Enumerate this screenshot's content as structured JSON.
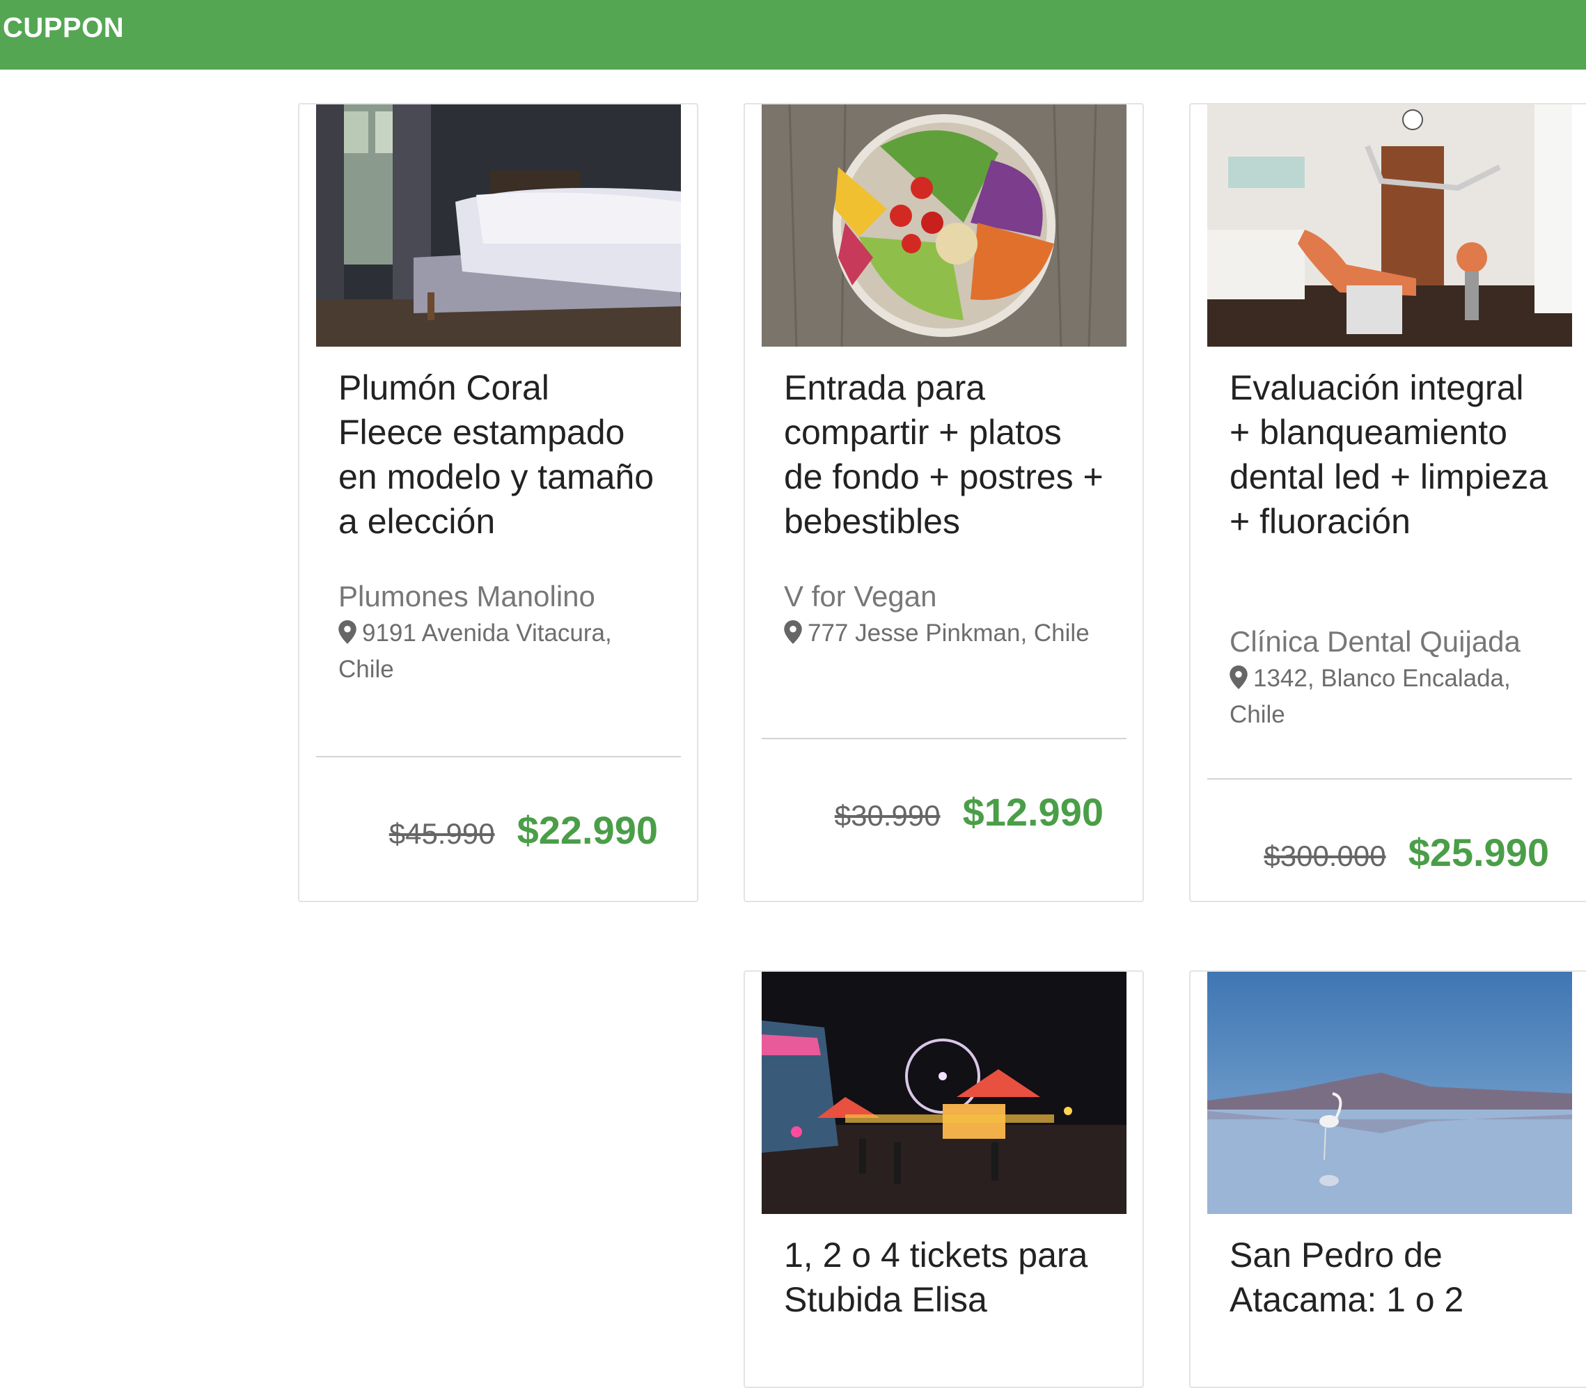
{
  "header": {
    "brand": "CUPPON",
    "bg_color": "#55a653"
  },
  "colors": {
    "price_accent": "#4a9e48",
    "old_price": "#666666"
  },
  "deals": [
    {
      "image": "bedroom-photo",
      "title": "Plumón Coral Fleece estampado en modelo y tamaño a elección",
      "merchant": "Plumones Manolino",
      "address": "9191 Avenida Vitacura, Chile",
      "old_price": "$45.990",
      "price": "$22.990"
    },
    {
      "image": "salad-bowl-photo",
      "title": "Entrada para compartir + platos de fondo + postres + bebestibles",
      "merchant": "V for Vegan",
      "address": "777 Jesse Pinkman, Chile",
      "old_price": "$30.990",
      "price": "$12.990"
    },
    {
      "image": "dental-clinic-photo",
      "title": "Evaluación integral + blanqueamiento dental led + limpieza + fluoración",
      "merchant": "Clínica Dental Quijada",
      "address": "1342, Blanco Encalada, Chile",
      "old_price": "$300.000",
      "price": "$25.990"
    },
    {
      "image": "fair-night-photo",
      "title": "1, 2 o 4 tickets para Stubida Elisa"
    },
    {
      "image": "flamingo-lake-photo",
      "title": "San Pedro de Atacama: 1 o 2"
    }
  ]
}
